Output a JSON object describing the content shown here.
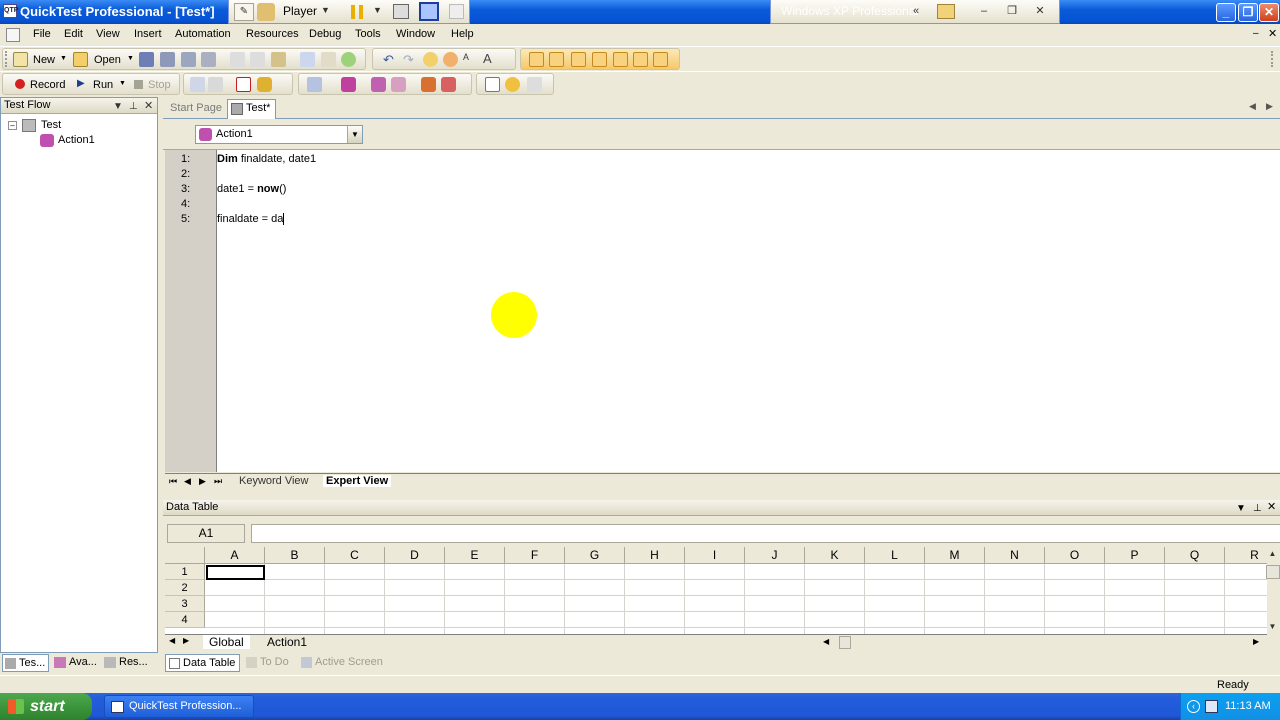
{
  "window": {
    "title": "QuickTest Professional - [Test*]",
    "app_icon_text": "QTP",
    "vm_name": "Windows XP Professional",
    "player_label": "Player"
  },
  "menu": {
    "items": [
      "File",
      "Edit",
      "View",
      "Insert",
      "Automation",
      "Resources",
      "Debug",
      "Tools",
      "Window",
      "Help"
    ]
  },
  "toolbar": {
    "new_label": "New",
    "open_label": "Open",
    "record_label": "Record",
    "run_label": "Run",
    "stop_label": "Stop"
  },
  "test_flow": {
    "title": "Test Flow",
    "tree": [
      {
        "label": "Test",
        "level": 0
      },
      {
        "label": "Action1",
        "level": 1
      }
    ]
  },
  "document_tabs": [
    "Start Page",
    "Test*"
  ],
  "action_selector": {
    "value": "Action1"
  },
  "editor": {
    "lines": [
      {
        "no": "1:",
        "kw": "Dim",
        "rest": " finaldate, date1"
      },
      {
        "no": "2:",
        "kw": "",
        "rest": ""
      },
      {
        "no": "3:",
        "pre": "date1 = ",
        "kw": "now",
        "rest": "()"
      },
      {
        "no": "4:",
        "kw": "",
        "rest": ""
      },
      {
        "no": "5:",
        "kw": "",
        "rest": "finaldate = da"
      }
    ]
  },
  "view_tabs": [
    "Keyword View",
    "Expert View"
  ],
  "data_table": {
    "title": "Data Table",
    "cell_ref": "A1",
    "columns": [
      "A",
      "B",
      "C",
      "D",
      "E",
      "F",
      "G",
      "H",
      "I",
      "J",
      "K",
      "L",
      "M",
      "N",
      "O",
      "P",
      "Q",
      "R"
    ],
    "rows": [
      "1",
      "2",
      "3",
      "4"
    ],
    "sheets": [
      "Global",
      "Action1"
    ]
  },
  "bottom_tabs": {
    "left": [
      "Tes...",
      "Ava...",
      "Res..."
    ],
    "right": [
      "Data Table",
      "To Do",
      "Active Screen"
    ]
  },
  "status": {
    "text": "Ready"
  },
  "taskbar": {
    "start_label": "start",
    "task_item": "QuickTest Profession...",
    "clock": "11:13 AM"
  },
  "colors": {
    "titlebar": "#0a5bd8",
    "cursor_highlight": "#ffff00",
    "taskbar": "#245edb",
    "start_button": "#3c963c"
  }
}
